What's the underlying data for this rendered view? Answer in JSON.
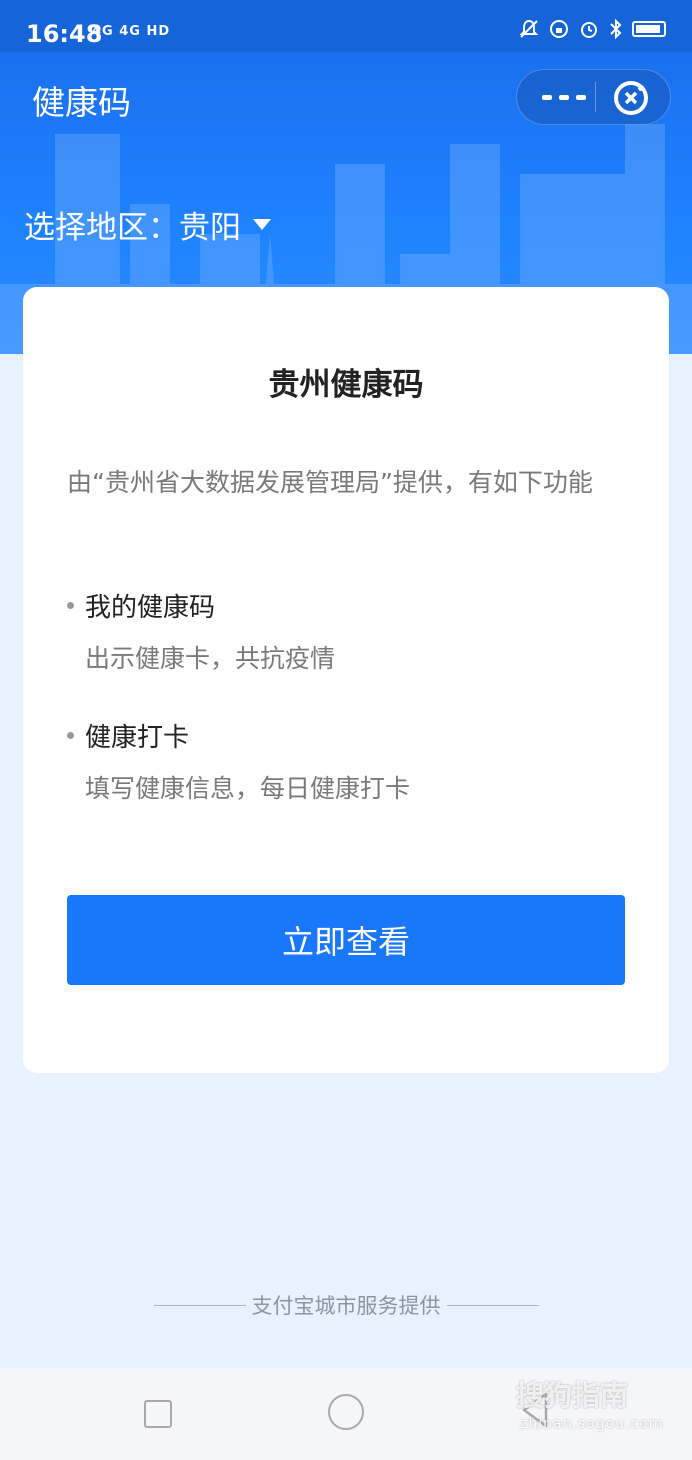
{
  "status_bar": {
    "time": "16:48",
    "network": "4G 4G HD"
  },
  "header": {
    "title": "健康码",
    "region_label": "选择地区：",
    "region_value": "贵阳"
  },
  "card": {
    "title": "贵州健康码",
    "description": "由“贵州省大数据发展管理局”提供，有如下功能",
    "features": [
      {
        "name": "我的健康码",
        "desc": "出示健康卡，共抗疫情"
      },
      {
        "name": "健康打卡",
        "desc": "填写健康信息，每日健康打卡"
      }
    ],
    "button_label": "立即查看"
  },
  "footer": {
    "text": "支付宝城市服务提供"
  },
  "watermark": {
    "brand": "搜狗指南",
    "url": "zhinan.sogou.com"
  },
  "colors": {
    "primary": "#1977fb",
    "header_bg": "#1f83ff",
    "page_bg": "#e8f2fe"
  }
}
